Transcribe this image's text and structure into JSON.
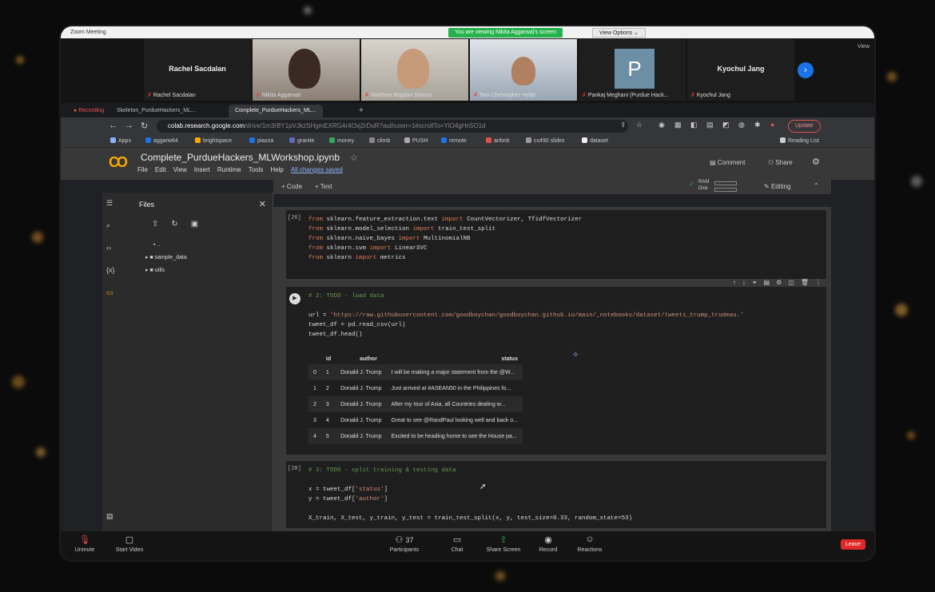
{
  "zoom": {
    "window_title": "Zoom Meeting",
    "viewing_banner": "You are viewing Nikita Aggarwal's screen",
    "view_options": "View Options ⌄",
    "view_corner": "View",
    "participants": [
      {
        "big_name": "Rachel Sacdalan",
        "name": "Rachel Sacdalan"
      },
      {
        "name": "Nikita Aggarwal"
      },
      {
        "name": "Matthew Bogdan Stancu"
      },
      {
        "name": "Tom Christopher Hylan"
      },
      {
        "avatar_letter": "P",
        "name": "Pankaj Meghani (Purdue Hack..."
      },
      {
        "big_name": "Kyochul Jang",
        "name": "Kyochul Jang"
      }
    ],
    "bottom": {
      "unmute": "Unmute",
      "start_video": "Start Video",
      "participants": "Participants",
      "participants_count": "37",
      "chat": "Chat",
      "share_screen": "Share Screen",
      "record": "Record",
      "reactions": "Reactions",
      "leave": "Leave"
    }
  },
  "browser": {
    "tabs": [
      "Recording",
      "Skeleton_PurdueHackers_ML...",
      "Complete_PurdueHackers_ML..."
    ],
    "new_tab": "+",
    "url_host": "colab.research.google.com",
    "url_path": "/drive/1m3rBY1pVJkzSHgmEXRG4r4Oxj2rDuR?authuser=1#scrollTo=YlO4gHn5O1d",
    "update": "Update",
    "bookmarks": [
      "Apps",
      "aggarw64",
      "brightspace",
      "piazza",
      "granite",
      "money",
      "climb",
      "PUSH",
      "remote",
      "airbnb",
      "cs490 slides",
      "dataset"
    ],
    "reading_list": "Reading List"
  },
  "colab": {
    "logo": "CO",
    "title": "Complete_PurdueHackers_MLWorkshop.ipynb",
    "menu": [
      "File",
      "Edit",
      "View",
      "Insert",
      "Runtime",
      "Tools",
      "Help"
    ],
    "saved": "All changes saved",
    "comment": "Comment",
    "share": "Share",
    "add_code": "+ Code",
    "add_text": "+ Text",
    "ram": "RAM",
    "disk": "Disk",
    "editing": "Editing",
    "files_title": "Files",
    "tree": [
      ".. ",
      "sample_data",
      "utils"
    ],
    "cells": {
      "c1_prompt": "[26]",
      "c2_comment": "# 2: TODO - load data",
      "c3_prompt": "[28]",
      "c3_comment": "# 3: TODO - split training & testing data"
    },
    "table": {
      "headers": [
        "",
        "id",
        "author",
        "status"
      ],
      "rows": [
        [
          "0",
          "1",
          "Donald J. Trump",
          "I will be making a major statement from the @W..."
        ],
        [
          "1",
          "2",
          "Donald J. Trump",
          "Just arrived at #ASEAN50 in the Philippines fo..."
        ],
        [
          "2",
          "3",
          "Donald J. Trump",
          "After my tour of Asia, all Countries dealing w..."
        ],
        [
          "3",
          "4",
          "Donald J. Trump",
          "Great to see @RandPaul looking well and back o..."
        ],
        [
          "4",
          "5",
          "Donald J. Trump",
          "Excited to be heading home to see the House pa..."
        ]
      ]
    }
  }
}
